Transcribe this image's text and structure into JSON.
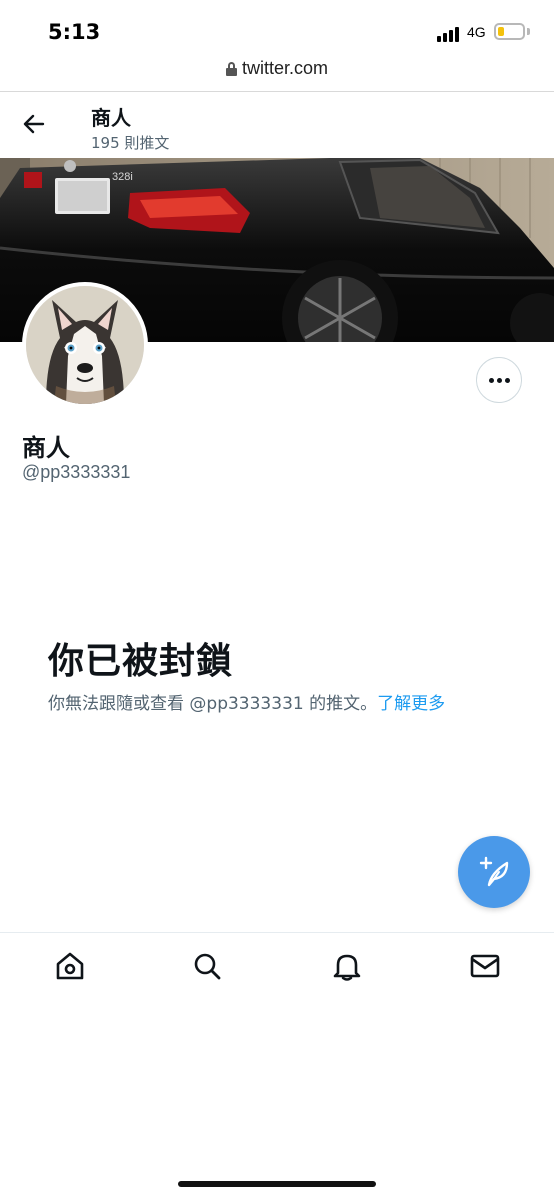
{
  "status_bar": {
    "time": "5:13",
    "network": "4G",
    "battery_level": 0.22,
    "battery_color": "#f4c20d"
  },
  "browser": {
    "url": "twitter.com",
    "lock_icon": "lock-icon"
  },
  "header": {
    "name": "商人",
    "tweet_count": "195 則推文",
    "back_icon": "arrow-left-icon"
  },
  "profile": {
    "display_name": "商人",
    "handle": "@pp3333331",
    "banner": "car-photo",
    "avatar": "husky-photo",
    "more_icon": "more-horizontal-icon"
  },
  "blocked": {
    "title": "你已被封鎖",
    "message": "你無法跟隨或查看 @pp3333331 的推文。",
    "learn_more": "了解更多",
    "link_color": "#1d9bf0"
  },
  "fab": {
    "icon": "compose-tweet-icon",
    "color": "#4a99e9"
  },
  "bottom_nav": {
    "items": [
      {
        "icon": "home-icon"
      },
      {
        "icon": "search-icon"
      },
      {
        "icon": "bell-icon"
      },
      {
        "icon": "mail-icon"
      }
    ]
  }
}
